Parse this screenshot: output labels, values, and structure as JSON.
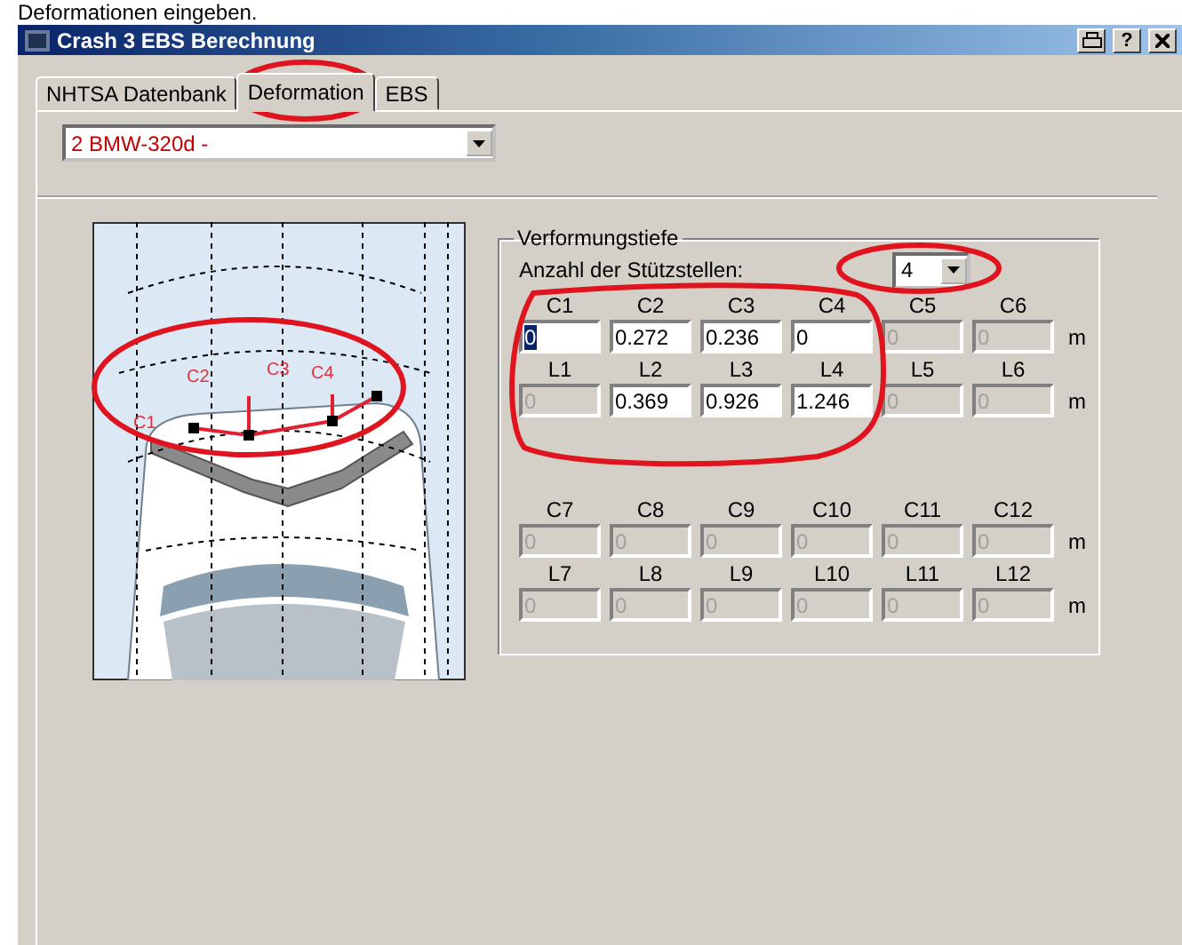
{
  "page_heading": "Deformationen eingeben.",
  "window": {
    "title": "Crash 3 EBS Berechnung",
    "help_button": "?"
  },
  "tabs": [
    {
      "label": "NHTSA Datenbank",
      "selected": false
    },
    {
      "label": "Deformation",
      "selected": true
    },
    {
      "label": "EBS",
      "selected": false
    }
  ],
  "vehicle_select": {
    "value": "2  BMW-320d -"
  },
  "diagram": {
    "labels": [
      "C1",
      "C2",
      "C3",
      "C4"
    ]
  },
  "deformation": {
    "title": "Verformungstiefe",
    "count_label": "Anzahl der Stützstellen:",
    "count_value": "4",
    "rows": [
      {
        "labels": [
          "C1",
          "C2",
          "C3",
          "C4",
          "C5",
          "C6"
        ],
        "unit": "m",
        "fields": [
          {
            "value": "0",
            "disabled": false,
            "selected": true
          },
          {
            "value": "0.272",
            "disabled": false,
            "selected": false
          },
          {
            "value": "0.236",
            "disabled": false,
            "selected": false
          },
          {
            "value": "0",
            "disabled": false,
            "selected": false
          },
          {
            "value": "0",
            "disabled": true,
            "selected": false
          },
          {
            "value": "0",
            "disabled": true,
            "selected": false
          }
        ]
      },
      {
        "labels": [
          "L1",
          "L2",
          "L3",
          "L4",
          "L5",
          "L6"
        ],
        "unit": "m",
        "fields": [
          {
            "value": "0",
            "disabled": true,
            "selected": false
          },
          {
            "value": "0.369",
            "disabled": false,
            "selected": false
          },
          {
            "value": "0.926",
            "disabled": false,
            "selected": false
          },
          {
            "value": "1.246",
            "disabled": false,
            "selected": false
          },
          {
            "value": "0",
            "disabled": true,
            "selected": false
          },
          {
            "value": "0",
            "disabled": true,
            "selected": false
          }
        ]
      },
      {
        "labels": [
          "C7",
          "C8",
          "C9",
          "C10",
          "C11",
          "C12"
        ],
        "unit": "m",
        "fields": [
          {
            "value": "0",
            "disabled": true,
            "selected": false
          },
          {
            "value": "0",
            "disabled": true,
            "selected": false
          },
          {
            "value": "0",
            "disabled": true,
            "selected": false
          },
          {
            "value": "0",
            "disabled": true,
            "selected": false
          },
          {
            "value": "0",
            "disabled": true,
            "selected": false
          },
          {
            "value": "0",
            "disabled": true,
            "selected": false
          }
        ]
      },
      {
        "labels": [
          "L7",
          "L8",
          "L9",
          "L10",
          "L11",
          "L12"
        ],
        "unit": "m",
        "fields": [
          {
            "value": "0",
            "disabled": true,
            "selected": false
          },
          {
            "value": "0",
            "disabled": true,
            "selected": false
          },
          {
            "value": "0",
            "disabled": true,
            "selected": false
          },
          {
            "value": "0",
            "disabled": true,
            "selected": false
          },
          {
            "value": "0",
            "disabled": true,
            "selected": false
          },
          {
            "value": "0",
            "disabled": true,
            "selected": false
          }
        ]
      }
    ]
  },
  "annotations": [
    {
      "color": "#e0141e"
    },
    {
      "color": "#e0141e"
    },
    {
      "color": "#e0141e"
    },
    {
      "color": "#e0141e"
    }
  ]
}
